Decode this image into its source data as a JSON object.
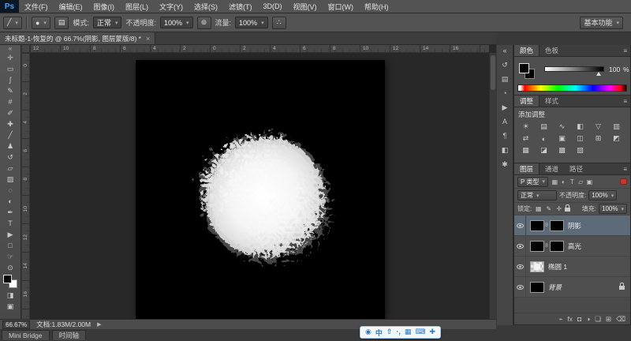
{
  "app": {
    "logo_text": "Ps"
  },
  "menubar": {
    "items": [
      "文件(F)",
      "编辑(E)",
      "图像(I)",
      "图层(L)",
      "文字(Y)",
      "选择(S)",
      "滤镜(T)",
      "3D(D)",
      "视图(V)",
      "窗口(W)",
      "帮助(H)"
    ]
  },
  "options_bar": {
    "brush_glyph": "╱",
    "dot_glyph": "●",
    "panel_toggle_glyph": "▤",
    "mode_label": "模式:",
    "mode_value": "正常",
    "opacity_label": "不透明度:",
    "opacity_value": "100%",
    "pressure_glyph": "⊚",
    "flow_label": "流量:",
    "flow_value": "100%",
    "airbrush_glyph": "∴",
    "workspace_button": "基本功能"
  },
  "document_tab": {
    "title": "未标题-1-恢复的 @ 66.7%(阴影, 图层蒙版/8) *",
    "close_glyph": "×"
  },
  "toolbar": {
    "collapse_glyph": "«",
    "tools": [
      {
        "name": "move-tool",
        "glyph": "✛"
      },
      {
        "name": "rectangular-marquee-tool",
        "glyph": "▭"
      },
      {
        "name": "lasso-tool",
        "glyph": "ʃ"
      },
      {
        "name": "quick-selection-tool",
        "glyph": "✎"
      },
      {
        "name": "crop-tool",
        "glyph": "#"
      },
      {
        "name": "eyedropper-tool",
        "glyph": "✐"
      },
      {
        "name": "healing-brush-tool",
        "glyph": "✚"
      },
      {
        "name": "brush-tool",
        "glyph": "╱"
      },
      {
        "name": "clone-stamp-tool",
        "glyph": "♟"
      },
      {
        "name": "history-brush-tool",
        "glyph": "↺"
      },
      {
        "name": "eraser-tool",
        "glyph": "▱"
      },
      {
        "name": "gradient-tool",
        "glyph": "▨"
      },
      {
        "name": "blur-tool",
        "glyph": "◌"
      },
      {
        "name": "dodge-tool",
        "glyph": "◐"
      },
      {
        "name": "pen-tool",
        "glyph": "✒"
      },
      {
        "name": "type-tool",
        "glyph": "T"
      },
      {
        "name": "path-selection-tool",
        "glyph": "▶"
      },
      {
        "name": "shape-tool",
        "glyph": "□"
      },
      {
        "name": "hand-tool",
        "glyph": "☞"
      },
      {
        "name": "zoom-tool",
        "glyph": "⊙"
      }
    ],
    "bottom_tools": [
      {
        "name": "quick-mask-icon",
        "glyph": "◨"
      },
      {
        "name": "screen-mode-icon",
        "glyph": "▣"
      }
    ]
  },
  "ruler": {
    "top_numbers": [
      "12",
      "10",
      "8",
      "6",
      "4",
      "2",
      "0",
      "2",
      "4",
      "6",
      "8",
      "10",
      "12",
      "14",
      "16"
    ],
    "left_numbers": [
      "0",
      "2",
      "4",
      "6",
      "8",
      "10",
      "12",
      "14",
      "16"
    ]
  },
  "right_dock": {
    "icons": [
      {
        "name": "collapse-panels-icon",
        "glyph": "«"
      },
      {
        "name": "history-icon",
        "glyph": "↺"
      },
      {
        "name": "properties-icon",
        "glyph": "▤"
      },
      {
        "name": "info-icon",
        "glyph": "◔"
      },
      {
        "name": "actions-icon",
        "glyph": "▶"
      },
      {
        "name": "character-icon",
        "glyph": "A"
      },
      {
        "name": "paragraph-icon",
        "glyph": "¶"
      },
      {
        "name": "masks-icon",
        "glyph": "◧"
      },
      {
        "name": "clone-source-icon",
        "glyph": "✱"
      }
    ]
  },
  "panels": {
    "color": {
      "tabs": [
        {
          "label": "颜色"
        },
        {
          "label": "色板"
        }
      ],
      "menu_glyph": "≡",
      "slider_value": "100",
      "slider_unit": "%"
    },
    "adjustments": {
      "tabs": [
        {
          "label": "调整"
        },
        {
          "label": "样式"
        }
      ],
      "menu_glyph": "≡",
      "add_label": "添加调整",
      "icons": [
        {
          "name": "brightness-contrast-icon",
          "glyph": "☀"
        },
        {
          "name": "levels-icon",
          "glyph": "▤"
        },
        {
          "name": "curves-icon",
          "glyph": "∿"
        },
        {
          "name": "exposure-icon",
          "glyph": "◧"
        },
        {
          "name": "vibrance-icon",
          "glyph": "▽"
        },
        {
          "name": "hue-saturation-icon",
          "glyph": "▥"
        },
        {
          "name": "color-balance-icon",
          "glyph": "⇄"
        },
        {
          "name": "black-white-icon",
          "glyph": "◐"
        },
        {
          "name": "photo-filter-icon",
          "glyph": "▣"
        },
        {
          "name": "channel-mixer-icon",
          "glyph": "◫"
        },
        {
          "name": "color-lookup-icon",
          "glyph": "⊞"
        },
        {
          "name": "invert-icon",
          "glyph": "◩"
        },
        {
          "name": "posterize-icon",
          "glyph": "▦"
        },
        {
          "name": "threshold-icon",
          "glyph": "◪"
        },
        {
          "name": "gradient-map-icon",
          "glyph": "▩"
        },
        {
          "name": "selective-color-icon",
          "glyph": "▨"
        }
      ]
    },
    "layers": {
      "tabs": [
        {
          "label": "图层"
        },
        {
          "label": "通道"
        },
        {
          "label": "路径"
        }
      ],
      "menu_glyph": "≡",
      "filter_prefix": "P",
      "filter_field": "类型",
      "filter_icons": [
        {
          "name": "pixel-layer-filter-icon",
          "glyph": "▦"
        },
        {
          "name": "adjustment-layer-filter-icon",
          "glyph": "◐"
        },
        {
          "name": "type-layer-filter-icon",
          "glyph": "T"
        },
        {
          "name": "shape-layer-filter-icon",
          "glyph": "▱"
        },
        {
          "name": "smart-object-filter-icon",
          "glyph": "▣"
        }
      ],
      "blend_mode": "正常",
      "opacity_label": "不透明度:",
      "opacity_value": "100%",
      "lock_label": "锁定:",
      "lock_icons": [
        {
          "name": "lock-transparency-icon",
          "glyph": "▦"
        },
        {
          "name": "lock-pixels-icon",
          "glyph": "✎"
        },
        {
          "name": "lock-position-icon",
          "glyph": "✛"
        },
        {
          "name": "lock-all-icon",
          "shape": "lock"
        }
      ],
      "fill_label": "填充:",
      "fill_value": "100%",
      "chain_glyph": "8",
      "rows": [
        {
          "name": "阴影",
          "selected": true,
          "kind": "mask"
        },
        {
          "name": "高光",
          "selected": false,
          "kind": "mask"
        },
        {
          "name": "椭圆 1",
          "selected": false,
          "kind": "shape"
        },
        {
          "name": "背景",
          "selected": false,
          "kind": "background"
        }
      ],
      "bottom_icons": [
        {
          "name": "link-layers-icon",
          "glyph": "⌁"
        },
        {
          "name": "layer-style-icon",
          "glyph": "fx"
        },
        {
          "name": "add-mask-icon",
          "glyph": "◘"
        },
        {
          "name": "adjustment-layer-icon",
          "glyph": "◑"
        },
        {
          "name": "new-group-icon",
          "glyph": "❏"
        },
        {
          "name": "new-layer-icon",
          "glyph": "⊞"
        },
        {
          "name": "delete-layer-icon",
          "glyph": "⌫"
        }
      ]
    }
  },
  "statusbar": {
    "zoom": "66.67%",
    "doc_info": "文档:1.83M/2.00M",
    "expand_glyph": "▶"
  },
  "bottom_tabs": [
    {
      "label": "Mini Bridge"
    },
    {
      "label": "时间轴"
    }
  ],
  "ime_bar": {
    "icons": [
      {
        "name": "ime-logo-icon",
        "glyph": "◉"
      },
      {
        "name": "ime-chinese-icon",
        "glyph": "中"
      },
      {
        "name": "ime-shift-icon",
        "glyph": "⇧"
      },
      {
        "name": "ime-punctuation-icon",
        "glyph": "·,"
      },
      {
        "name": "ime-emoji-icon",
        "glyph": "▦"
      },
      {
        "name": "ime-keyboard-icon",
        "glyph": "⌨"
      },
      {
        "name": "ime-settings-icon",
        "glyph": "✚"
      }
    ]
  }
}
